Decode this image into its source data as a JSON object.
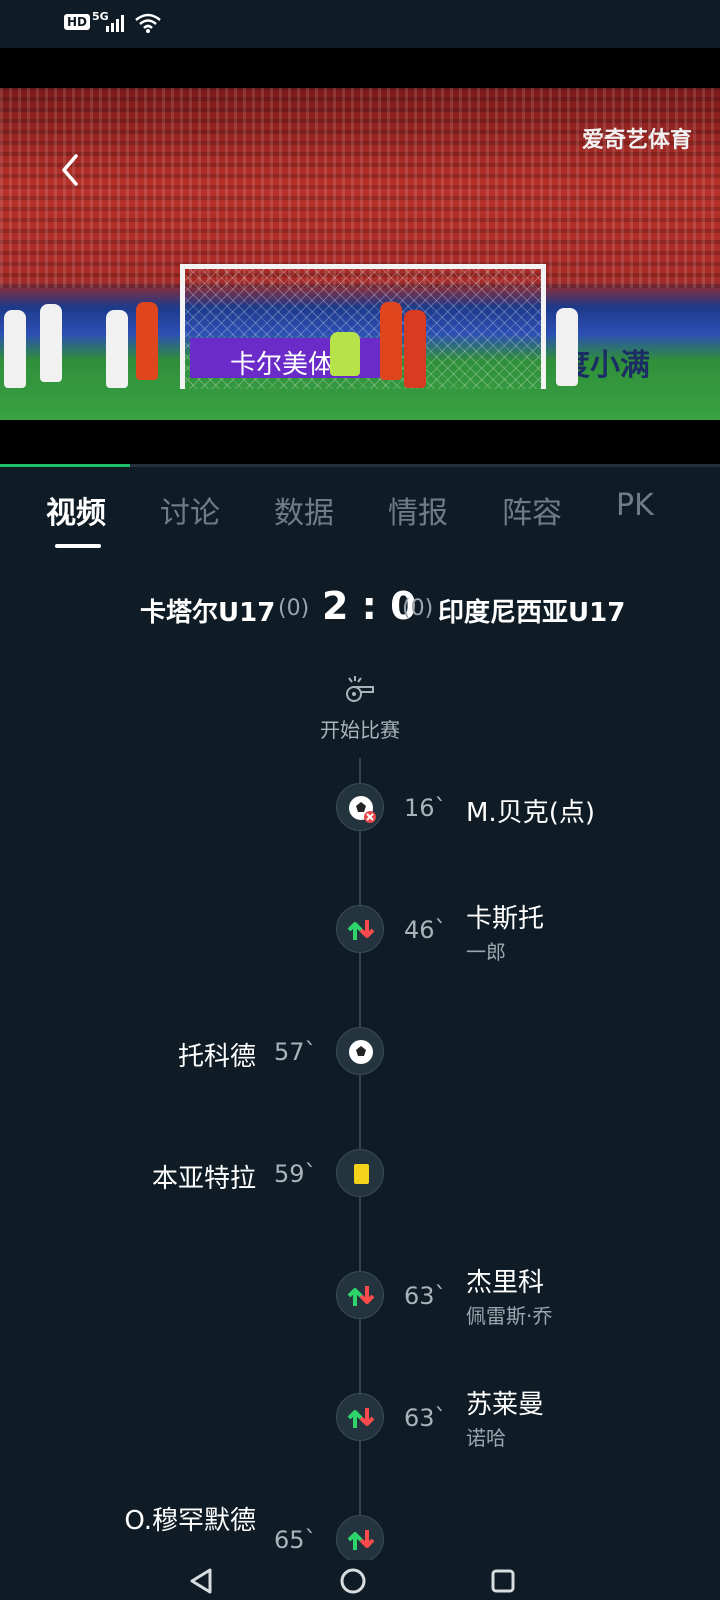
{
  "status_bar": {
    "hd_label": "HD",
    "network_label": "5G"
  },
  "video": {
    "brand": "爱奇艺体育",
    "board_left": "卡尔美体",
    "board_right": "度小满",
    "progress": 0.18
  },
  "tabs": [
    {
      "label": "视频"
    },
    {
      "label": "讨论"
    },
    {
      "label": "数据"
    },
    {
      "label": "情报"
    },
    {
      "label": "阵容"
    },
    {
      "label": "PK"
    }
  ],
  "match": {
    "home_team": "卡塔尔U17",
    "home_pen": "(0)",
    "score": "2 : 0",
    "away_pen": "(0)",
    "away_team": "印度尼西亚U17"
  },
  "kickoff_label": "开始比赛",
  "events": [
    {
      "side": "right",
      "type": "goal-missed",
      "minute": "16`",
      "player": "M.贝克(点)",
      "sub": ""
    },
    {
      "side": "right",
      "type": "substitution",
      "minute": "46`",
      "player": "卡斯托",
      "sub": "一郎"
    },
    {
      "side": "left",
      "type": "goal",
      "minute": "57`",
      "player": "托科德",
      "sub": ""
    },
    {
      "side": "left",
      "type": "yellow-card",
      "minute": "59`",
      "player": "本亚特拉",
      "sub": ""
    },
    {
      "side": "right",
      "type": "substitution",
      "minute": "63`",
      "player": "杰里科",
      "sub": "佩雷斯·乔"
    },
    {
      "side": "right",
      "type": "substitution",
      "minute": "63`",
      "player": "苏莱曼",
      "sub": "诺哈"
    },
    {
      "side": "left",
      "type": "substitution",
      "minute": "65`",
      "player": "O.穆罕默德",
      "sub": ""
    }
  ],
  "colors": {
    "background": "#0f1c25",
    "accent": "#1fbf6a",
    "yellow_card": "#f5d21a",
    "sub_in": "#2fd46a",
    "sub_out": "#ff4b4b"
  }
}
